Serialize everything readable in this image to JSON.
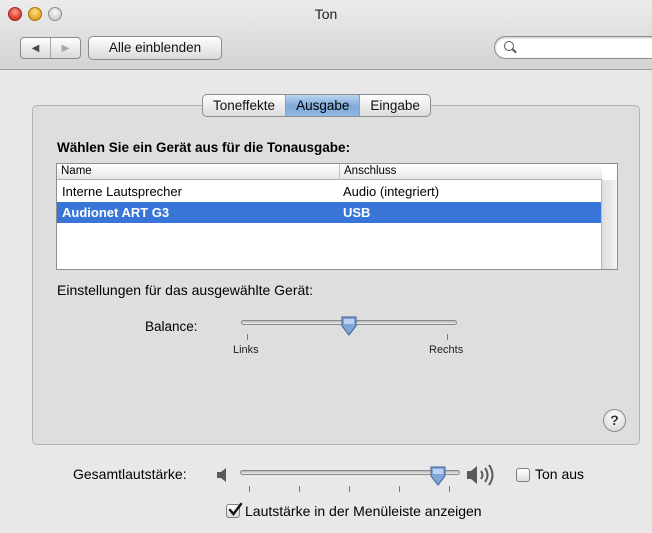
{
  "window": {
    "title": "Ton"
  },
  "toolbar": {
    "back_glyph": "◀",
    "forward_glyph": "▶",
    "show_all_label": "Alle einblenden",
    "search_placeholder": ""
  },
  "tabs": [
    {
      "label": "Toneffekte",
      "active": false
    },
    {
      "label": "Ausgabe",
      "active": true
    },
    {
      "label": "Eingabe",
      "active": false
    }
  ],
  "output": {
    "heading": "Wählen Sie ein Gerät aus für die Tonausgabe:",
    "columns": [
      "Name",
      "Anschluss"
    ],
    "devices": [
      {
        "name": "Interne Lautsprecher",
        "connection": "Audio (integriert)",
        "selected": false
      },
      {
        "name": "Audionet ART G3",
        "connection": "USB",
        "selected": true
      }
    ],
    "settings_label": "Einstellungen für das ausgewählte Gerät:",
    "balance": {
      "label": "Balance:",
      "left_label": "Links",
      "right_label": "Rechts",
      "value": 0.5
    }
  },
  "help_label": "?",
  "volume": {
    "label": "Gesamtlautstärke:",
    "value": 0.9,
    "mute_label": "Ton aus",
    "mute_checked": false,
    "menubar_label": "Lautstärke in der Menüleiste anzeigen",
    "menubar_checked": true
  },
  "colors": {
    "selection": "#3875d7",
    "active_tab": "#7ea9da"
  },
  "icons": {
    "low_volume": "speaker-low-icon",
    "high_volume": "speaker-high-icon",
    "search": "magnifier-icon",
    "help": "help-icon"
  }
}
